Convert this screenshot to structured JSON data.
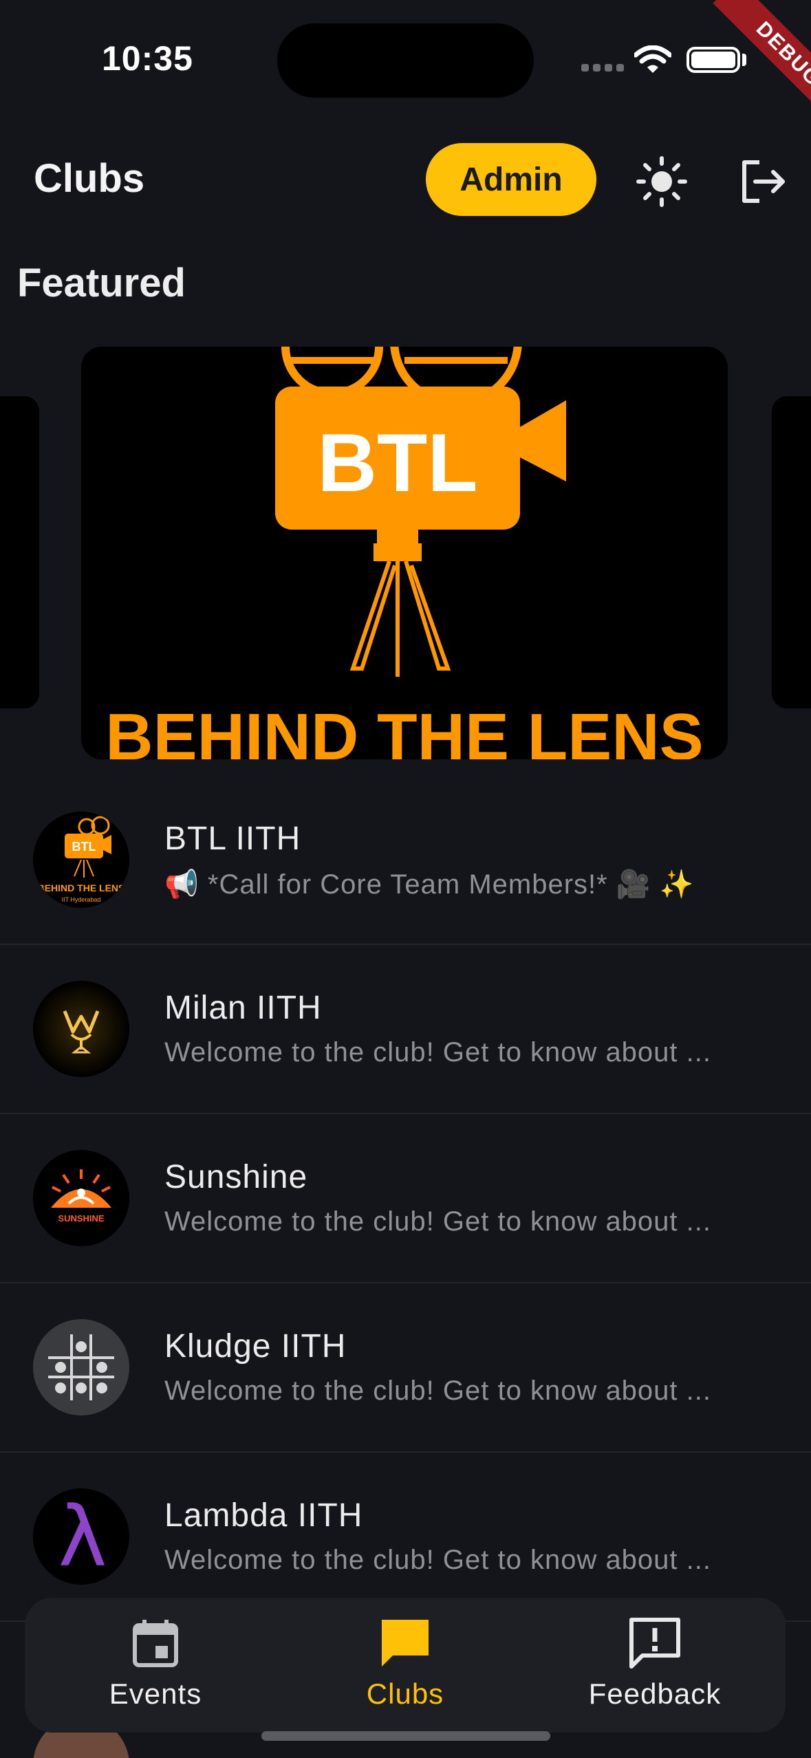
{
  "status_bar": {
    "time": "10:35"
  },
  "debug_banner": "DEBUG",
  "app_bar": {
    "title": "Clubs",
    "admin_label": "Admin",
    "theme_icon": "sun-icon",
    "logout_icon": "logout-icon"
  },
  "featured": {
    "section_title": "Featured",
    "card": {
      "logo_text": "BTL",
      "tagline": "BEHIND THE LENS"
    }
  },
  "clubs": [
    {
      "name": "BTL IITH",
      "subtitle": "📢 *Call for Core Team Members!* 🎥 ✨",
      "avatar_text": "BEHIND THE LENS",
      "avatar_sub": "IIT Hyderabad"
    },
    {
      "name": "Milan IITH",
      "subtitle": "Welcome to the club! Get to know about ..."
    },
    {
      "name": "Sunshine",
      "subtitle": "Welcome to the club! Get to know about ...",
      "avatar_text": "SUNSHINE"
    },
    {
      "name": "Kludge IITH",
      "subtitle": "Welcome to the club! Get to know about ..."
    },
    {
      "name": "Lambda IITH",
      "subtitle": "Welcome to the club! Get to know about ...",
      "avatar_text": "λ"
    }
  ],
  "bottom_nav": {
    "items": [
      {
        "label": "Events",
        "icon": "calendar-icon"
      },
      {
        "label": "Clubs",
        "icon": "chat-icon",
        "active": true
      },
      {
        "label": "Feedback",
        "icon": "feedback-icon"
      }
    ]
  },
  "colors": {
    "accent": "#ffc107",
    "background": "#13151b",
    "nav_background": "#1d1f25",
    "btl_orange": "#ff9800"
  }
}
